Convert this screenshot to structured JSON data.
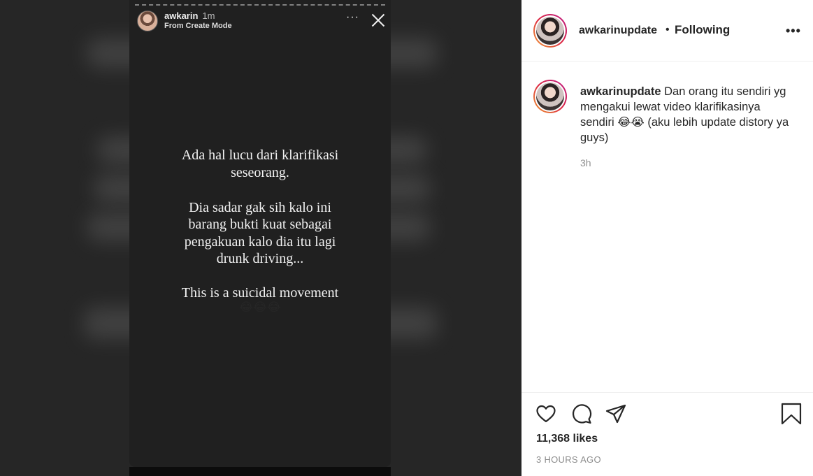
{
  "story": {
    "username": "awkarin",
    "time": "1m",
    "subtitle": "From Create Mode",
    "more_icon": "···",
    "lines": [
      "Ada hal lucu dari klarifikasi",
      "seseorang.",
      "",
      "Dia sadar gak sih kalo ini",
      "barang bukti kuat sebagai",
      "pengakuan kalo dia itu lagi",
      "drunk driving...",
      "",
      "This is a suicidal movement"
    ],
    "emojis": "😂😂😂"
  },
  "post_header": {
    "username": "awkarinupdate",
    "separator": "•",
    "follow_status": "Following",
    "more_icon": "•••"
  },
  "caption": {
    "username": "awkarinupdate",
    "text": "Dan orang itu sendiri yg mengakui lewat video klarifikasinya sendiri 😂😭 (aku lebih update distory ya guys)",
    "time_ago": "3h"
  },
  "footer": {
    "likes": "11,368 likes",
    "posted": "3 HOURS AGO"
  },
  "icons": [
    "heart-icon",
    "comment-icon",
    "share-icon",
    "bookmark-icon",
    "close-icon",
    "more-icon"
  ]
}
